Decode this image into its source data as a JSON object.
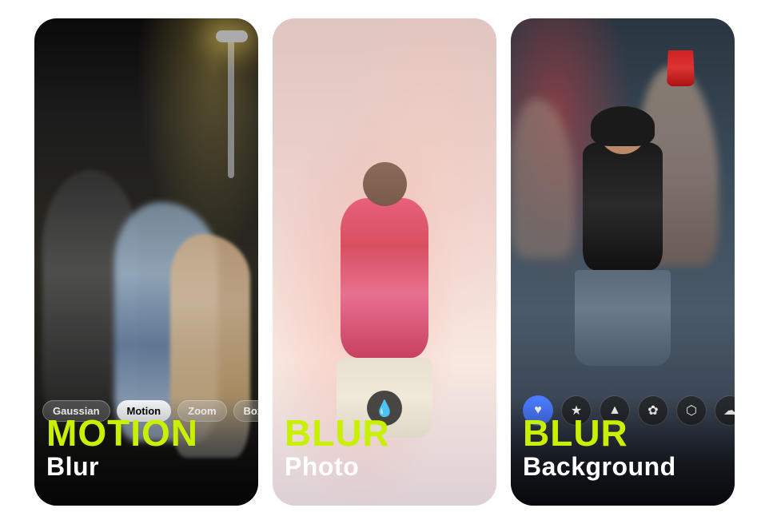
{
  "cards": [
    {
      "id": "card-1",
      "main_title": "MOTION",
      "sub_title": "Blur",
      "chips": [
        {
          "label": "Gaussian",
          "active": false
        },
        {
          "label": "Motion",
          "active": true
        },
        {
          "label": "Zoom",
          "active": false
        },
        {
          "label": "Box",
          "active": false
        }
      ]
    },
    {
      "id": "card-2",
      "main_title": "BLUR",
      "sub_title": "Photo",
      "icon": "💧"
    },
    {
      "id": "card-3",
      "main_title": "BLUR",
      "sub_title": "Background",
      "icons": [
        {
          "symbol": "♥",
          "style": "filled-blue",
          "name": "heart-icon"
        },
        {
          "symbol": "★",
          "style": "outline-dark",
          "name": "star-icon"
        },
        {
          "symbol": "▲",
          "style": "outline-dark",
          "name": "triangle-icon"
        },
        {
          "symbol": "✿",
          "style": "outline-dark",
          "name": "flower-icon"
        },
        {
          "symbol": "⬡",
          "style": "outline-dark",
          "name": "hexagon-icon"
        },
        {
          "symbol": "☁",
          "style": "outline-dark",
          "name": "cloud-icon"
        }
      ]
    }
  ],
  "accent_color": "#c8f000"
}
